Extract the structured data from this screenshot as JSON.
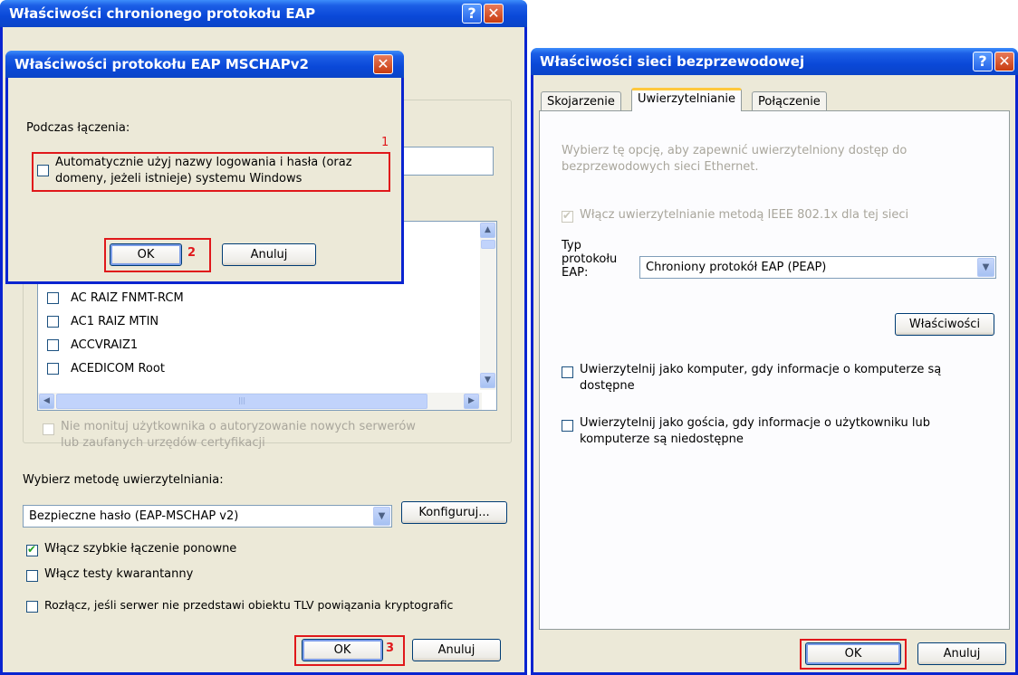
{
  "peap_dialog": {
    "title": "Właściwości chronionego protokołu EAP",
    "help": "?",
    "close": "✕",
    "cert_list": [
      "AC RAIZ FNMT-RCM",
      "AC1 RAIZ MTIN",
      "ACCVRAIZ1",
      "ACEDICOM Root"
    ],
    "no_prompt_label": "Nie monituj użytkownika o autoryzowanie nowych serwerów",
    "no_prompt_label2": "lub zaufanych urzędów certyfikacji",
    "auth_method_label": "Wybierz metodę uwierzytelniania:",
    "auth_method_value": "Bezpieczne hasło (EAP-MSCHAP v2)",
    "configure_button": "Konfiguruj...",
    "fast_reconnect_label": "Włącz szybkie łączenie ponowne",
    "quarantine_label": "Włącz testy kwarantanny",
    "disconnect_label": "Rozłącz, jeśli serwer nie przedstawi obiektu TLV powiązania kryptografic",
    "ok_button": "OK",
    "cancel_button": "Anuluj",
    "annotation": "3"
  },
  "mschap_dialog": {
    "title": "Właściwości protokołu EAP MSCHAPv2",
    "close": "✕",
    "connecting_label": "Podczas łączenia:",
    "auto_logon_label": "Automatycznie użyj nazwy logowania i hasła (oraz",
    "auto_logon_label2": "domeny, jeżeli istnieje) systemu Windows",
    "ok_button": "OK",
    "cancel_button": "Anuluj",
    "annotation1": "1",
    "annotation2": "2"
  },
  "wireless_dialog": {
    "title": "Właściwości sieci bezprzewodowej",
    "help": "?",
    "close": "✕",
    "tabs": [
      "Skojarzenie",
      "Uwierzytelnianie",
      "Połączenie"
    ],
    "info_text": "Wybierz tę opcję, aby zapewnić uwierzytelniony dostęp do",
    "info_text2": "bezprzewodowych sieci Ethernet.",
    "ieee_label": "Włącz uwierzytelnianie metodą IEEE 802.1x dla tej sieci",
    "eap_type_label1": "Typ",
    "eap_type_label2": "protokołu",
    "eap_type_label3": "EAP:",
    "eap_type_value": "Chroniony protokół EAP (PEAP)",
    "properties_button": "Właściwości",
    "auth_computer_label": "Uwierzytelnij jako komputer, gdy informacje o komputerze są",
    "auth_computer_label2": "dostępne",
    "auth_guest_label": "Uwierzytelnij jako gościa, gdy informacje o użytkowniku lub",
    "auth_guest_label2": "komputerze są niedostępne",
    "ok_button": "OK",
    "cancel_button": "Anuluj"
  },
  "colors": {
    "xp_blue": "#0a48d8",
    "dialog_bg": "#ece9d8",
    "annotation_red": "#e0181b"
  }
}
